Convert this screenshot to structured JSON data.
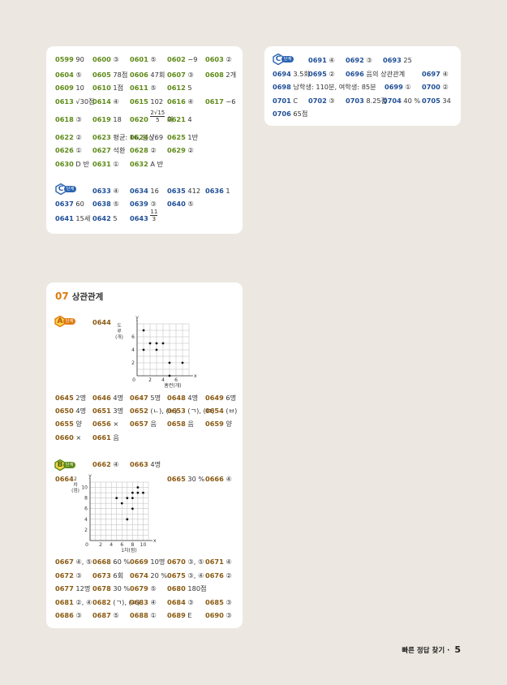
{
  "card1": {
    "rows": [
      [
        {
          "n": "0599",
          "v": "90"
        },
        {
          "n": "0600",
          "v": "③"
        },
        {
          "n": "0601",
          "v": "⑤"
        },
        {
          "n": "0602",
          "v": "−9"
        },
        {
          "n": "0603",
          "v": "②"
        }
      ],
      [
        {
          "n": "0604",
          "v": "⑤"
        },
        {
          "n": "0605",
          "v": "78점"
        },
        {
          "n": "0606",
          "v": "47회"
        },
        {
          "n": "0607",
          "v": "③"
        },
        {
          "n": "0608",
          "v": "2개"
        }
      ],
      [
        {
          "n": "0609",
          "v": "10"
        },
        {
          "n": "0610",
          "v": "1점"
        },
        {
          "n": "0611",
          "v": "⑤"
        },
        {
          "n": "0612",
          "v": "5"
        }
      ],
      [
        {
          "n": "0613",
          "v": "√30점"
        },
        {
          "n": "0614",
          "v": "④"
        },
        {
          "n": "0615",
          "v": "102"
        },
        {
          "n": "0616",
          "v": "④"
        },
        {
          "n": "0617",
          "v": "−6"
        }
      ],
      [
        {
          "n": "0618",
          "v": "③"
        },
        {
          "n": "0619",
          "v": "18"
        },
        {
          "n": "0620",
          "v": "2√15/5 회"
        },
        {
          "n": "0621",
          "v": "4"
        }
      ],
      [
        {
          "n": "0622",
          "v": "②"
        },
        {
          "n": "0623",
          "v": "평균: 16, 분산: 9"
        },
        {
          "n": "0624",
          "v": "√6"
        },
        {
          "n": "0625",
          "v": "1반"
        }
      ],
      [
        {
          "n": "0626",
          "v": "①"
        },
        {
          "n": "0627",
          "v": "석환"
        },
        {
          "n": "0628",
          "v": "②"
        },
        {
          "n": "0629",
          "v": "②"
        }
      ],
      [
        {
          "n": "0630",
          "v": "D 반"
        },
        {
          "n": "0631",
          "v": "①"
        },
        {
          "n": "0632",
          "v": "A 반"
        }
      ]
    ],
    "c_badge": {
      "letter": "C",
      "label": "단계"
    },
    "c_rows": [
      [
        {
          "n": "0633",
          "v": "④"
        },
        {
          "n": "0634",
          "v": "16"
        },
        {
          "n": "0635",
          "v": "412"
        },
        {
          "n": "0636",
          "v": "1"
        }
      ],
      [
        {
          "n": "0637",
          "v": "60"
        },
        {
          "n": "0638",
          "v": "⑤"
        },
        {
          "n": "0639",
          "v": "③"
        },
        {
          "n": "0640",
          "v": "⑤"
        }
      ],
      [
        {
          "n": "0641",
          "v": "15세"
        },
        {
          "n": "0642",
          "v": "5"
        },
        {
          "n": "0643",
          "v": "11/3"
        }
      ]
    ]
  },
  "card2": {
    "badge": {
      "letter": "C",
      "label": "단계"
    },
    "rows": [
      [
        {
          "n": "0691",
          "v": "④"
        },
        {
          "n": "0692",
          "v": "③"
        },
        {
          "n": "0693",
          "v": "25"
        }
      ],
      [
        {
          "n": "0694",
          "v": "3.5회"
        },
        {
          "n": "0695",
          "v": "②"
        },
        {
          "n": "0696",
          "v": "음의 상관관계"
        },
        {
          "n": "0697",
          "v": "④"
        }
      ],
      [
        {
          "n": "0698",
          "v": "남학생: 110분, 여학생: 85분"
        },
        {
          "n": "0699",
          "v": "①"
        },
        {
          "n": "0700",
          "v": "②"
        }
      ],
      [
        {
          "n": "0701",
          "v": "C"
        },
        {
          "n": "0702",
          "v": "③"
        },
        {
          "n": "0703",
          "v": "8.25점"
        },
        {
          "n": "0704",
          "v": "40 %"
        },
        {
          "n": "0705",
          "v": "34"
        }
      ],
      [
        {
          "n": "0706",
          "v": "65점"
        }
      ]
    ]
  },
  "card3": {
    "section": {
      "num": "07",
      "title": "상관관계"
    },
    "a_badge": {
      "letter": "A",
      "label": "단계"
    },
    "q0644": "0644",
    "chart1": {
      "type": "scatter",
      "ylabel": "도루(개)",
      "xlabel": "홈런(개)",
      "x_axis_letter": "x",
      "y_axis_letter": "y",
      "origin": "0",
      "xticks": [
        2,
        4,
        6
      ],
      "yticks": [
        2,
        4,
        6
      ],
      "xlim": [
        0,
        8
      ],
      "ylim": [
        0,
        8
      ],
      "points": [
        [
          1,
          7
        ],
        [
          1,
          4
        ],
        [
          2,
          5
        ],
        [
          3,
          5
        ],
        [
          3,
          4
        ],
        [
          4,
          5
        ],
        [
          5,
          2
        ],
        [
          5,
          0
        ],
        [
          7,
          2
        ]
      ]
    },
    "rows_a": [
      [
        {
          "n": "0645",
          "v": "2명"
        },
        {
          "n": "0646",
          "v": "4명"
        },
        {
          "n": "0647",
          "v": "5명"
        },
        {
          "n": "0648",
          "v": "4명"
        },
        {
          "n": "0649",
          "v": "6명"
        }
      ],
      [
        {
          "n": "0650",
          "v": "4명"
        },
        {
          "n": "0651",
          "v": "3명"
        },
        {
          "n": "0652",
          "v": "(ㄴ), (ㅂ)"
        },
        {
          "n": "0653",
          "v": "(ㄱ), (ㅁ)"
        },
        {
          "n": "0654",
          "v": "(ㅂ)"
        }
      ],
      [
        {
          "n": "0655",
          "v": "양"
        },
        {
          "n": "0656",
          "v": "×"
        },
        {
          "n": "0657",
          "v": "음"
        },
        {
          "n": "0658",
          "v": "음"
        },
        {
          "n": "0659",
          "v": "양"
        }
      ],
      [
        {
          "n": "0660",
          "v": "×"
        },
        {
          "n": "0661",
          "v": "음"
        }
      ]
    ],
    "b_badge": {
      "letter": "B",
      "label": "단계"
    },
    "b_first": [
      {
        "n": "0662",
        "v": "④"
      },
      {
        "n": "0663",
        "v": "4명"
      }
    ],
    "q0664": "0664",
    "chart2": {
      "type": "scatter",
      "ylabel": "2차(점)",
      "xlabel": "1차(점)",
      "x_axis_letter": "x",
      "y_axis_letter": "y",
      "origin": "0",
      "xticks": [
        2,
        4,
        6,
        8,
        10
      ],
      "yticks": [
        2,
        4,
        6,
        8,
        10
      ],
      "xlim": [
        0,
        11
      ],
      "ylim": [
        0,
        11
      ],
      "points": [
        [
          5,
          8
        ],
        [
          6,
          7
        ],
        [
          7,
          8
        ],
        [
          7,
          4
        ],
        [
          8,
          8
        ],
        [
          8,
          6
        ],
        [
          8,
          9
        ],
        [
          9,
          10
        ],
        [
          9,
          9
        ],
        [
          10,
          9
        ]
      ]
    },
    "b_side": [
      {
        "n": "0665",
        "v": "30 %"
      },
      {
        "n": "0666",
        "v": "④"
      }
    ],
    "rows_b": [
      [
        {
          "n": "0667",
          "v": "④, ⑤"
        },
        {
          "n": "0668",
          "v": "60 %"
        },
        {
          "n": "0669",
          "v": "10명"
        },
        {
          "n": "0670",
          "v": "③, ⑤"
        },
        {
          "n": "0671",
          "v": "④"
        }
      ],
      [
        {
          "n": "0672",
          "v": "③"
        },
        {
          "n": "0673",
          "v": "6회"
        },
        {
          "n": "0674",
          "v": "20 %"
        },
        {
          "n": "0675",
          "v": "③, ④"
        },
        {
          "n": "0676",
          "v": "②"
        }
      ],
      [
        {
          "n": "0677",
          "v": "12명"
        },
        {
          "n": "0678",
          "v": "30 %"
        },
        {
          "n": "0679",
          "v": "⑤"
        },
        {
          "n": "0680",
          "v": "180점"
        }
      ],
      [
        {
          "n": "0681",
          "v": "②, ④"
        },
        {
          "n": "0682",
          "v": "(ㄱ), (ㄹ)"
        },
        {
          "n": "0683",
          "v": "④"
        },
        {
          "n": "0684",
          "v": "③"
        },
        {
          "n": "0685",
          "v": "③"
        }
      ],
      [
        {
          "n": "0686",
          "v": "③"
        },
        {
          "n": "0687",
          "v": "⑤"
        },
        {
          "n": "0688",
          "v": "①"
        },
        {
          "n": "0689",
          "v": "E"
        },
        {
          "n": "0690",
          "v": "③"
        }
      ]
    ]
  },
  "footer": {
    "title": "빠른 정답 찾기",
    "sep": "·",
    "page": "5"
  }
}
